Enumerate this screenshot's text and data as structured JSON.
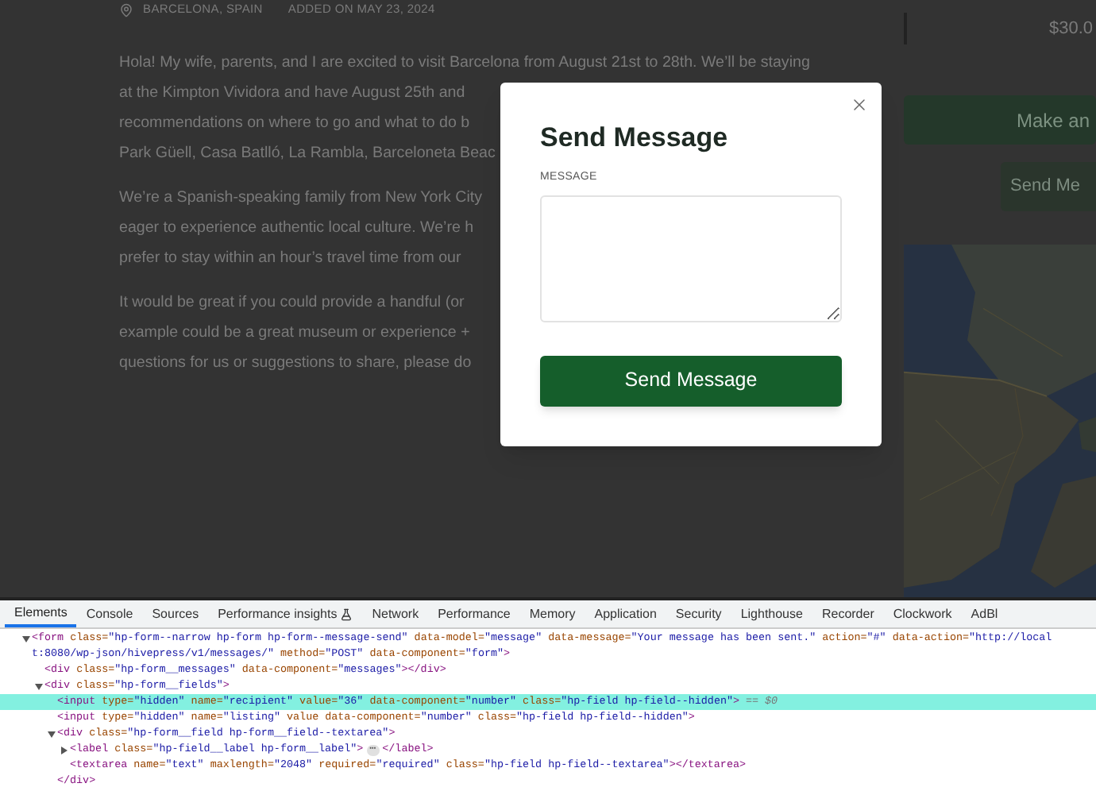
{
  "listing": {
    "location": "BARCELONA, SPAIN",
    "added": "ADDED ON MAY 23, 2024",
    "paragraphs": [
      [
        "Hola! My wife, parents, and I are excited to visit Barcelona from August 21st to 28th. We’ll be staying",
        "at the Kimpton Vividora and have August 25th and",
        "recommendations on where to go and what to do b",
        "Park Güell, Casa Batlló, La Rambla, Barceloneta Beac"
      ],
      [
        "We’re a Spanish-speaking family from New York City",
        "eager to experience authentic local culture. We’re h",
        "prefer to stay within an hour’s travel time from our"
      ],
      [
        "It would be great if you could provide a handful (or",
        "example could be a great museum or experience +",
        "questions for us or suggestions to share, please do"
      ]
    ]
  },
  "sidebar": {
    "price": "$30.0",
    "offer_button": "Make an",
    "message_button": "Send Me"
  },
  "modal": {
    "title": "Send Message",
    "field_label": "MESSAGE",
    "submit": "Send Message"
  },
  "devtools": {
    "tabs": [
      {
        "label": "Elements",
        "selected": true,
        "experimental": false
      },
      {
        "label": "Console",
        "selected": false,
        "experimental": false
      },
      {
        "label": "Sources",
        "selected": false,
        "experimental": false
      },
      {
        "label": "Performance insights",
        "selected": false,
        "experimental": true
      },
      {
        "label": "Network",
        "selected": false,
        "experimental": false
      },
      {
        "label": "Performance",
        "selected": false,
        "experimental": false
      },
      {
        "label": "Memory",
        "selected": false,
        "experimental": false
      },
      {
        "label": "Application",
        "selected": false,
        "experimental": false
      },
      {
        "label": "Security",
        "selected": false,
        "experimental": false
      },
      {
        "label": "Lighthouse",
        "selected": false,
        "experimental": false
      },
      {
        "label": "Recorder",
        "selected": false,
        "experimental": false
      },
      {
        "label": "Clockwork",
        "selected": false,
        "experimental": false
      },
      {
        "label": "AdBl",
        "selected": false,
        "experimental": false
      }
    ],
    "tree": [
      {
        "selected": false,
        "expanded": true,
        "open": [
          {
            "kind": "tag",
            "t": "<form"
          },
          {
            "kind": "attr",
            "t": " class="
          },
          {
            "kind": "val",
            "t": "\"hp-form--narrow hp-form hp-form--message-send\""
          },
          {
            "kind": "attr",
            "t": " data-model="
          },
          {
            "kind": "val",
            "t": "\"message\""
          },
          {
            "kind": "attr",
            "t": " data-message="
          },
          {
            "kind": "val",
            "t": "\"Your message has been sent.\""
          },
          {
            "kind": "attr",
            "t": " action="
          },
          {
            "kind": "val",
            "t": "\"#\""
          },
          {
            "kind": "attr",
            "t": " data-action="
          },
          {
            "kind": "val",
            "t": "\"http://local"
          }
        ],
        "wrap": [
          {
            "kind": "val",
            "t": "t:8080/wp-json/hivepress/v1/messages/\""
          },
          {
            "kind": "attr",
            "t": " method="
          },
          {
            "kind": "val",
            "t": "\"POST\""
          },
          {
            "kind": "attr",
            "t": " data-component="
          },
          {
            "kind": "val",
            "t": "\"form\""
          },
          {
            "kind": "tag",
            "t": ">"
          }
        ],
        "children": [
          {
            "selected": false,
            "open": [
              {
                "kind": "tag",
                "t": "<div"
              },
              {
                "kind": "attr",
                "t": " class="
              },
              {
                "kind": "val",
                "t": "\"hp-form__messages\""
              },
              {
                "kind": "attr",
                "t": " data-component="
              },
              {
                "kind": "val",
                "t": "\"messages\""
              },
              {
                "kind": "tag",
                "t": "></div>"
              }
            ]
          },
          {
            "selected": false,
            "expanded": true,
            "open": [
              {
                "kind": "tag",
                "t": "<div"
              },
              {
                "kind": "attr",
                "t": " class="
              },
              {
                "kind": "val",
                "t": "\"hp-form__fields\""
              },
              {
                "kind": "tag",
                "t": ">"
              }
            ],
            "children": [
              {
                "selected": true,
                "suffix": "== $0",
                "open": [
                  {
                    "kind": "tag",
                    "t": "<input"
                  },
                  {
                    "kind": "attr",
                    "t": " type="
                  },
                  {
                    "kind": "val",
                    "t": "\"hidden\""
                  },
                  {
                    "kind": "attr",
                    "t": " name="
                  },
                  {
                    "kind": "val",
                    "t": "\"recipient\""
                  },
                  {
                    "kind": "attr",
                    "t": " value="
                  },
                  {
                    "kind": "val",
                    "t": "\"36\""
                  },
                  {
                    "kind": "attr",
                    "t": " data-component="
                  },
                  {
                    "kind": "val",
                    "t": "\"number\""
                  },
                  {
                    "kind": "attr",
                    "t": " class="
                  },
                  {
                    "kind": "val",
                    "t": "\"hp-field hp-field--hidden\""
                  },
                  {
                    "kind": "tag",
                    "t": ">"
                  }
                ]
              },
              {
                "selected": false,
                "open": [
                  {
                    "kind": "tag",
                    "t": "<input"
                  },
                  {
                    "kind": "attr",
                    "t": " type="
                  },
                  {
                    "kind": "val",
                    "t": "\"hidden\""
                  },
                  {
                    "kind": "attr",
                    "t": " name="
                  },
                  {
                    "kind": "val",
                    "t": "\"listing\""
                  },
                  {
                    "kind": "attr",
                    "t": " value data-component="
                  },
                  {
                    "kind": "val",
                    "t": "\"number\""
                  },
                  {
                    "kind": "attr",
                    "t": " class="
                  },
                  {
                    "kind": "val",
                    "t": "\"hp-field hp-field--hidden\""
                  },
                  {
                    "kind": "tag",
                    "t": ">"
                  }
                ]
              },
              {
                "selected": false,
                "expanded": true,
                "open": [
                  {
                    "kind": "tag",
                    "t": "<div"
                  },
                  {
                    "kind": "attr",
                    "t": " class="
                  },
                  {
                    "kind": "val",
                    "t": "\"hp-form__field hp-form__field--textarea\""
                  },
                  {
                    "kind": "tag",
                    "t": ">"
                  }
                ],
                "children": [
                  {
                    "selected": false,
                    "expanded": false,
                    "open": [
                      {
                        "kind": "tag",
                        "t": "<label"
                      },
                      {
                        "kind": "attr",
                        "t": " class="
                      },
                      {
                        "kind": "val",
                        "t": "\"hp-field__label hp-form__label\""
                      },
                      {
                        "kind": "tag",
                        "t": ">"
                      },
                      {
                        "kind": "badge",
                        "t": "⋯"
                      },
                      {
                        "kind": "tag",
                        "t": "</label>"
                      }
                    ]
                  },
                  {
                    "selected": false,
                    "open": [
                      {
                        "kind": "tag",
                        "t": "<textarea"
                      },
                      {
                        "kind": "attr",
                        "t": " name="
                      },
                      {
                        "kind": "val",
                        "t": "\"text\""
                      },
                      {
                        "kind": "attr",
                        "t": " maxlength="
                      },
                      {
                        "kind": "val",
                        "t": "\"2048\""
                      },
                      {
                        "kind": "attr",
                        "t": " required="
                      },
                      {
                        "kind": "val",
                        "t": "\"required\""
                      },
                      {
                        "kind": "attr",
                        "t": " class="
                      },
                      {
                        "kind": "val",
                        "t": "\"hp-field hp-field--textarea\""
                      },
                      {
                        "kind": "tag",
                        "t": "></textarea>"
                      }
                    ]
                  }
                ],
                "close": [
                  {
                    "kind": "tag",
                    "t": "</div>"
                  }
                ]
              }
            ]
          }
        ]
      }
    ]
  }
}
